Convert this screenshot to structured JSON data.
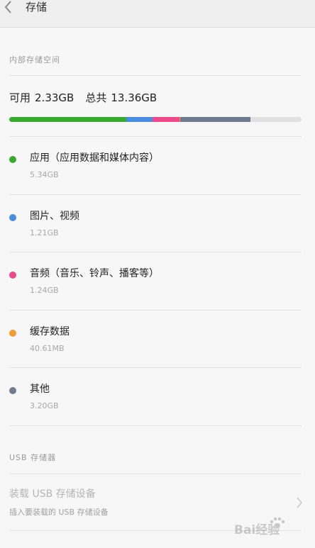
{
  "header": {
    "title": "存储"
  },
  "internal": {
    "section_title": "内部存储空间",
    "available_label": "可用",
    "available_value": "2.33GB",
    "total_label": "总共",
    "total_value": "13.36GB"
  },
  "colors": {
    "apps": "#3aa92f",
    "pictures": "#4a8de0",
    "audio": "#ec4a8a",
    "cache": "#f49b35",
    "other": "#6f7b8f",
    "free": "#e0e0e0"
  },
  "breakdown": [
    {
      "label": "应用（应用数据和媒体内容）",
      "size": "5.34GB",
      "fraction": 0.3997,
      "color": "#3aa92f"
    },
    {
      "label": "图片、视频",
      "size": "1.21GB",
      "fraction": 0.0906,
      "color": "#4a8de0"
    },
    {
      "label": "音频（音乐、铃声、播客等）",
      "size": "1.24GB",
      "fraction": 0.0928,
      "color": "#ec4a8a"
    },
    {
      "label": "缓存数据",
      "size": "40.61MB",
      "fraction": 0.003,
      "color": "#f49b35"
    },
    {
      "label": "其他",
      "size": "3.20GB",
      "fraction": 0.2395,
      "color": "#6f7b8f"
    }
  ],
  "usb": {
    "section_title": "USB 存储器",
    "mount_label": "装载 USB 存储设备",
    "mount_desc": "插入要装载的 USB 存储设备"
  },
  "watermark": {
    "text": "Bai经验"
  }
}
